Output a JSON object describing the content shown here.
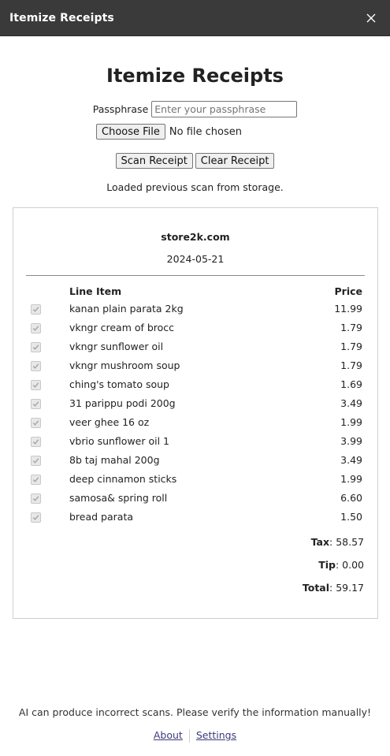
{
  "window": {
    "title": "Itemize Receipts"
  },
  "page": {
    "heading": "Itemize Receipts"
  },
  "form": {
    "passphrase_label": "Passphrase",
    "passphrase_placeholder": "Enter your passphrase",
    "passphrase_value": "",
    "choose_file_label": "Choose File",
    "file_status": "No file chosen",
    "scan_label": "Scan Receipt",
    "clear_label": "Clear Receipt",
    "status": "Loaded previous scan from storage."
  },
  "receipt": {
    "store": "store2k.com",
    "date": "2024-05-21",
    "columns": {
      "item": "Line Item",
      "price": "Price"
    },
    "items": [
      {
        "name": "kanan plain parata 2kg",
        "price": "11.99",
        "checked": true
      },
      {
        "name": "vkngr cream of brocc",
        "price": "1.79",
        "checked": true
      },
      {
        "name": "vkngr sunflower oil",
        "price": "1.79",
        "checked": true
      },
      {
        "name": "vkngr mushroom soup",
        "price": "1.79",
        "checked": true
      },
      {
        "name": "ching's tomato soup",
        "price": "1.69",
        "checked": true
      },
      {
        "name": "31 parippu podi 200g",
        "price": "3.49",
        "checked": true
      },
      {
        "name": "veer ghee 16 oz",
        "price": "1.99",
        "checked": true
      },
      {
        "name": "vbrio sunflower oil 1",
        "price": "3.99",
        "checked": true
      },
      {
        "name": "8b taj mahal 200g",
        "price": "3.49",
        "checked": true
      },
      {
        "name": "deep cinnamon sticks",
        "price": "1.99",
        "checked": true
      },
      {
        "name": "samosa& spring roll",
        "price": "6.60",
        "checked": true
      },
      {
        "name": "bread parata",
        "price": "1.50",
        "checked": true
      }
    ],
    "tax_label": "Tax",
    "tax_value": ": 58.57",
    "tip_label": "Tip",
    "tip_value": ": 0.00",
    "total_label": "Total",
    "total_value": ": 59.17"
  },
  "footer": {
    "disclaimer": "AI can produce incorrect scans. Please verify the information manually!",
    "about_label": "About",
    "settings_label": "Settings"
  },
  "icons": {
    "close": "close-icon",
    "checkbox": "checkmark-icon"
  }
}
